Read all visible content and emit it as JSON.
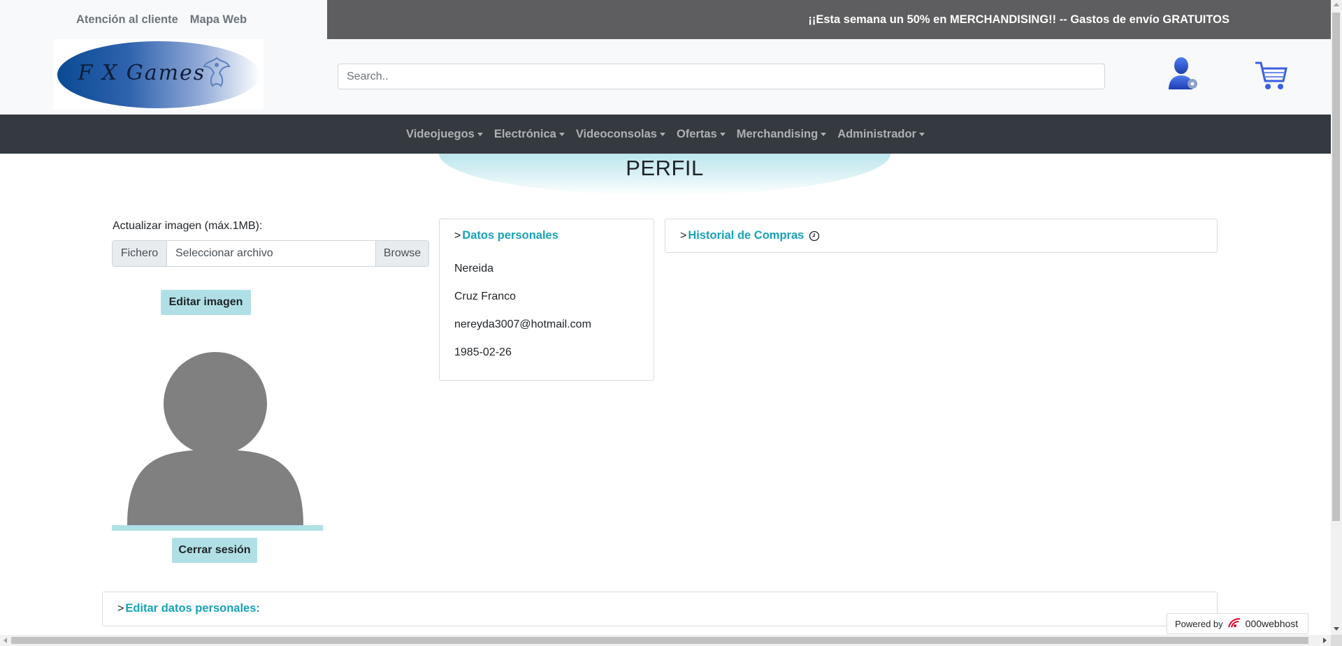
{
  "topbar": {
    "customer_service": "Atención al cliente",
    "site_map": "Mapa Web",
    "promo": "¡¡Esta semana un 50% en MERCHANDISING!! -- Gastos de envío GRATUITOS",
    "promo_bg": "#5e5e60"
  },
  "header": {
    "logo_text": "F X Games",
    "search_placeholder": "Search..",
    "user_icon": "user-settings-icon",
    "cart_icon": "shopping-cart-icon"
  },
  "nav": {
    "items": [
      {
        "label": "Videojuegos"
      },
      {
        "label": "Electrónica"
      },
      {
        "label": "Videoconsolas"
      },
      {
        "label": "Ofertas"
      },
      {
        "label": "Merchandising"
      },
      {
        "label": "Administrador"
      }
    ],
    "bg": "#343a40"
  },
  "page": {
    "title": "PERFIL"
  },
  "image_upload": {
    "label": "Actualizar imagen (máx.1MB):",
    "prefix": "Fichero",
    "file_placeholder": "Seleccionar archivo",
    "browse": "Browse",
    "edit_button": "Editar imagen",
    "logout_button": "Cerrar sesión",
    "accent": "#b0e0e6"
  },
  "datos": {
    "arrow": ">",
    "title": "Datos personales",
    "first_name": "Nereida",
    "last_name": "Cruz Franco",
    "email": "nereyda3007@hotmail.com",
    "birth_date": "1985-02-26"
  },
  "historial": {
    "arrow": ">",
    "title": "Historial de Compras",
    "icon": "clock-icon"
  },
  "editar": {
    "arrow": ">",
    "title": "Editar datos personales:"
  },
  "powered": {
    "label": "Powered by",
    "brand": "000webhost"
  },
  "link_color": "#17a2b8"
}
